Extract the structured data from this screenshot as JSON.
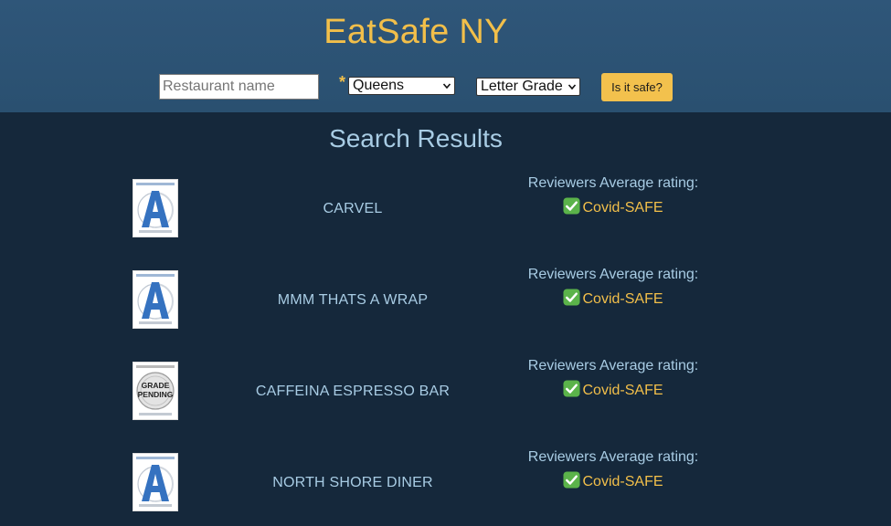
{
  "header": {
    "title": "EatSafe NY",
    "search": {
      "placeholder": "Restaurant name",
      "value": "",
      "required_marker": "*",
      "borough_selected": "Queens",
      "grade_selected": "Letter Grade",
      "submit_label": "Is it safe?"
    }
  },
  "results": {
    "title": "Search Results",
    "items": [
      {
        "name": "CARVEL",
        "grade_badge": "grade-a-icon",
        "rating_label": "Reviewers Average rating:",
        "status": "Covid-SAFE",
        "status_icon": "check-mark-icon"
      },
      {
        "name": "MMM THATS A WRAP",
        "grade_badge": "grade-a-icon",
        "rating_label": "Reviewers Average rating:",
        "status": "Covid-SAFE",
        "status_icon": "check-mark-icon"
      },
      {
        "name": "CAFFEINA ESPRESSO BAR",
        "grade_badge": "grade-pending-icon",
        "badge_text": [
          "GRADE",
          "PENDING"
        ],
        "rating_label": "Reviewers Average rating:",
        "status": "Covid-SAFE",
        "status_icon": "check-mark-icon"
      },
      {
        "name": "NORTH SHORE DINER",
        "grade_badge": "grade-a-icon",
        "rating_label": "Reviewers Average rating:",
        "status": "Covid-SAFE",
        "status_icon": "check-mark-icon"
      }
    ]
  },
  "colors": {
    "header_bg": "#2c5374",
    "page_bg": "#15283b",
    "accent_gold": "#f2bf4a",
    "text_light_blue": "#a8cce4",
    "grade_blue": "#3572c0"
  }
}
